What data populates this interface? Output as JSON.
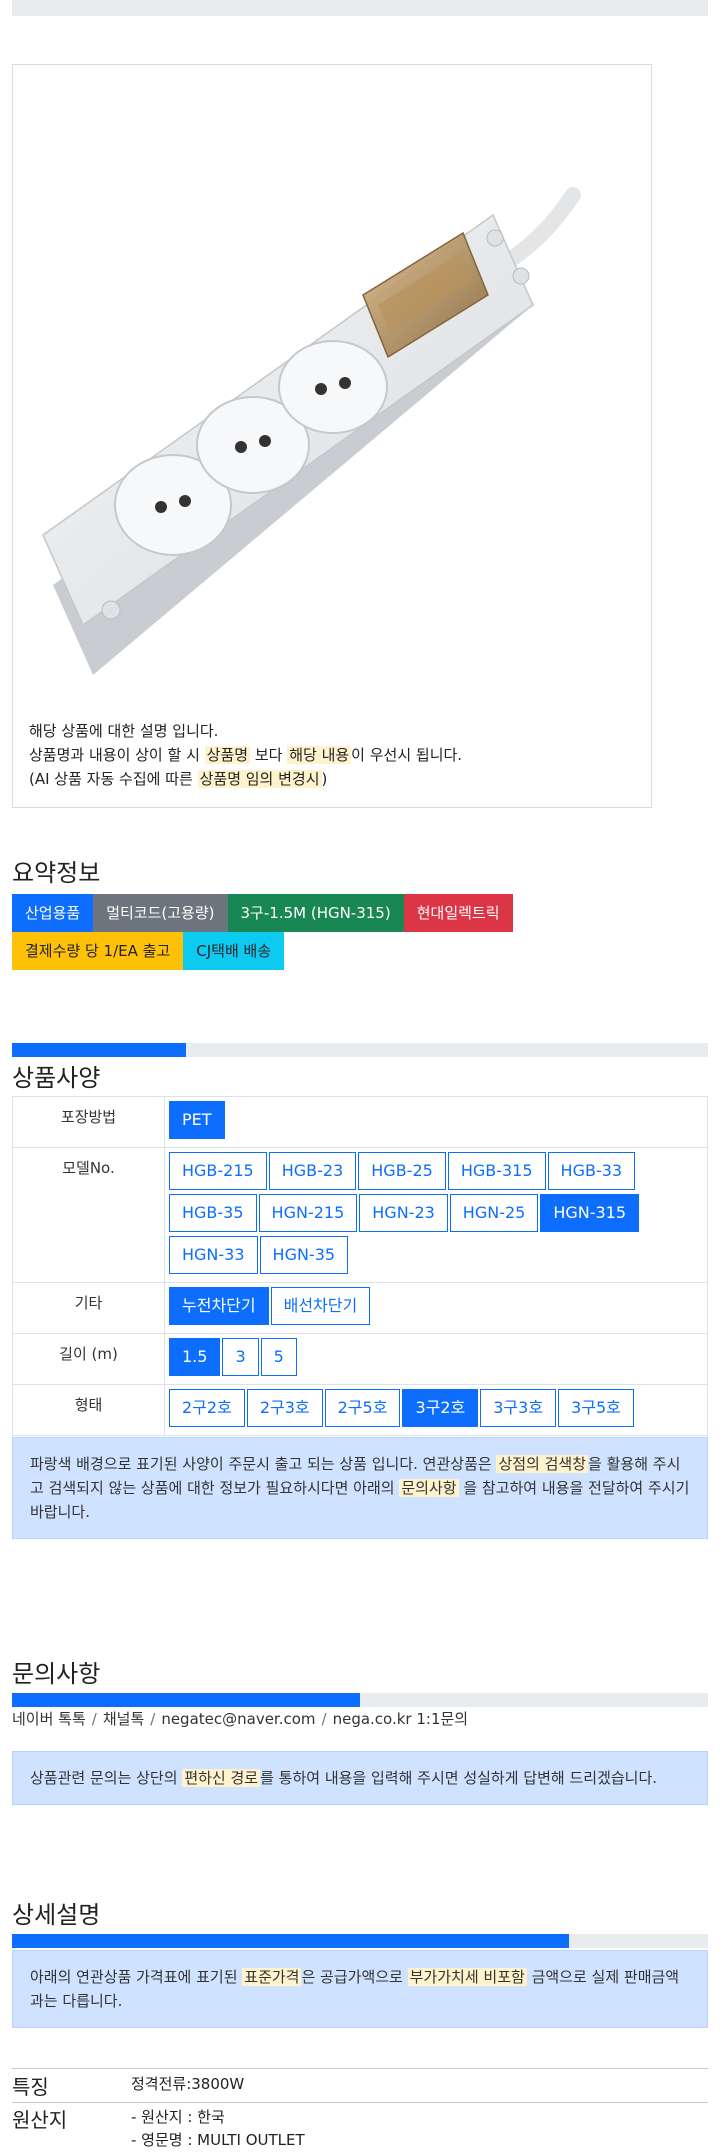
{
  "product": {
    "description_lines": [
      [
        "해당 상품에 대한 설명 입니다."
      ],
      [
        "상품명과 내용이 상이 할 시 ",
        "상품명",
        " 보다 ",
        "해당 내용",
        "이 우선시 됩니다."
      ],
      [
        "(AI 상품 자동 수집에 따른 ",
        "상품명 임의 변경시",
        ")"
      ]
    ]
  },
  "summary": {
    "title": "요약정보",
    "badges_row1": [
      {
        "label": "산업용품",
        "color": "#0d6efd"
      },
      {
        "label": "멀티코드(고용량)",
        "color": "#6c757d"
      },
      {
        "label": "3구-1.5M (HGN-315)",
        "color": "#198754"
      },
      {
        "label": "현대일렉트릭",
        "color": "#dc3545"
      }
    ],
    "badges_row2": [
      {
        "label": "결제수량 당 1/EA 출고",
        "color": "#ffc107",
        "text_color": "#212529"
      },
      {
        "label": "CJ택배 배송",
        "color": "#0dcaf0",
        "text_color": "#212529"
      }
    ]
  },
  "spec": {
    "progress": 0.25,
    "title": "상품사양",
    "rows": [
      {
        "label": "포장방법",
        "options": [
          {
            "text": "PET",
            "selected": true
          }
        ]
      },
      {
        "label": "모델No.",
        "options": [
          {
            "text": "HGB-215",
            "selected": false
          },
          {
            "text": "HGB-23",
            "selected": false
          },
          {
            "text": "HGB-25",
            "selected": false
          },
          {
            "text": "HGB-315",
            "selected": false
          },
          {
            "text": "HGB-33",
            "selected": false
          },
          {
            "text": "HGB-35",
            "selected": false
          },
          {
            "text": "HGN-215",
            "selected": false
          },
          {
            "text": "HGN-23",
            "selected": false
          },
          {
            "text": "HGN-25",
            "selected": false
          },
          {
            "text": "HGN-315",
            "selected": true
          },
          {
            "text": "HGN-33",
            "selected": false
          },
          {
            "text": "HGN-35",
            "selected": false
          }
        ]
      },
      {
        "label": "기타",
        "options": [
          {
            "text": "누전차단기",
            "selected": true
          },
          {
            "text": "배선차단기",
            "selected": false
          }
        ]
      },
      {
        "label": "길이 (m)",
        "options": [
          {
            "text": "1.5",
            "selected": true
          },
          {
            "text": "3",
            "selected": false
          },
          {
            "text": "5",
            "selected": false
          }
        ]
      },
      {
        "label": "형태",
        "options": [
          {
            "text": "2구2호",
            "selected": false
          },
          {
            "text": "2구3호",
            "selected": false
          },
          {
            "text": "2구5호",
            "selected": false
          },
          {
            "text": "3구2호",
            "selected": true
          },
          {
            "text": "3구3호",
            "selected": false
          },
          {
            "text": "3구5호",
            "selected": false
          }
        ]
      }
    ],
    "notice": [
      "파랑색 배경으로 표기된 사양이 주문시 출고 되는 상품 입니다. 연관상품은 ",
      "상점의 검색창",
      "을 활용해 주시고 검색되지 않는 상품에 대한 정보가 필요하시다면 아래의 ",
      "문의사항",
      " 을 참고하여 내용을 전달하여 주시기 바랍니다."
    ]
  },
  "inquiry": {
    "title": "문의사항",
    "progress": 0.5,
    "channels": [
      "네이버 톡톡",
      "채널톡",
      "negatec@naver.com",
      "nega.co.kr 1:1문의"
    ],
    "notice": [
      "상품관련 문의는 상단의 ",
      "편하신 경로",
      "를 통하여 내용을 입력해 주시면 성실하게 답변해 드리겠습니다."
    ]
  },
  "detail": {
    "title": "상세설명",
    "progress": 0.8,
    "notice": [
      "아래의 연관상품 가격표에 표기된 ",
      "표준가격",
      "은 공급가액으로 ",
      "부가가치세 비포함",
      " 금액으로 실제 판매금액과는 다릅니다."
    ],
    "features": [
      {
        "key": "특징",
        "values": [
          "정격전류:3800W"
        ]
      },
      {
        "key": "원산지",
        "values": [
          "- 원산지 : 한국",
          "- 영문명 : MULTI OUTLET"
        ]
      }
    ]
  }
}
